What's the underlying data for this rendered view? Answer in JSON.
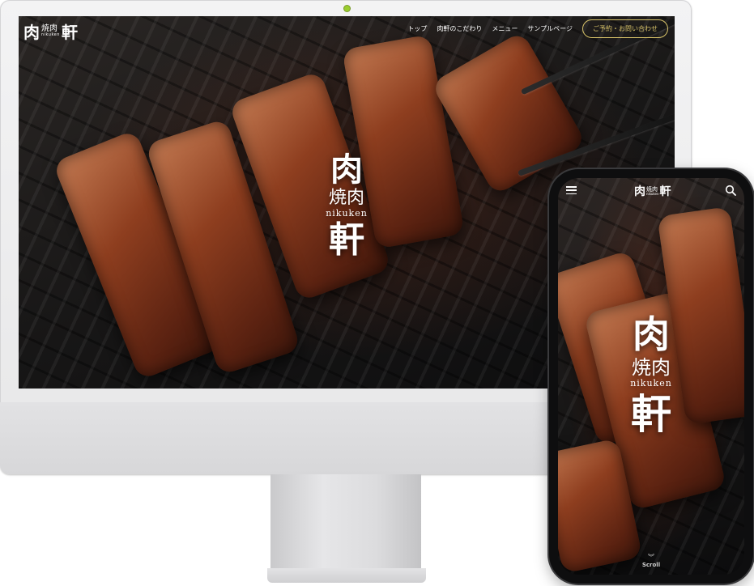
{
  "desktop": {
    "logo": {
      "glyph_left": "肉",
      "small_jp": "焼肉",
      "small_roman": "nikuken",
      "glyph_right": "軒"
    },
    "nav": {
      "items": [
        "トップ",
        "肉軒のこだわり",
        "メニュー",
        "サンプルページ"
      ],
      "contact_label": "ご予約・お問い合わせ"
    },
    "hero": {
      "glyph_top": "肉",
      "middle": "焼肉",
      "roman": "nikuken",
      "glyph_bottom": "軒"
    }
  },
  "mobile": {
    "logo": {
      "glyph_left": "肉",
      "small_jp": "焼肉",
      "small_roman": "nikuken",
      "glyph_right": "軒"
    },
    "icons": {
      "menu": "hamburger-menu-icon",
      "search": "search-icon"
    },
    "hero": {
      "glyph_top": "肉",
      "middle": "焼肉",
      "roman": "nikuken",
      "glyph_bottom": "軒"
    },
    "scroll_label": "Scroll",
    "scroll_chevron": "︾"
  },
  "colors": {
    "accent_gold": "#d9c46a",
    "camera_dot": "#9acd2f",
    "bezel_phone": "#0e0e0f",
    "monitor_body": "#e7e7e8"
  }
}
